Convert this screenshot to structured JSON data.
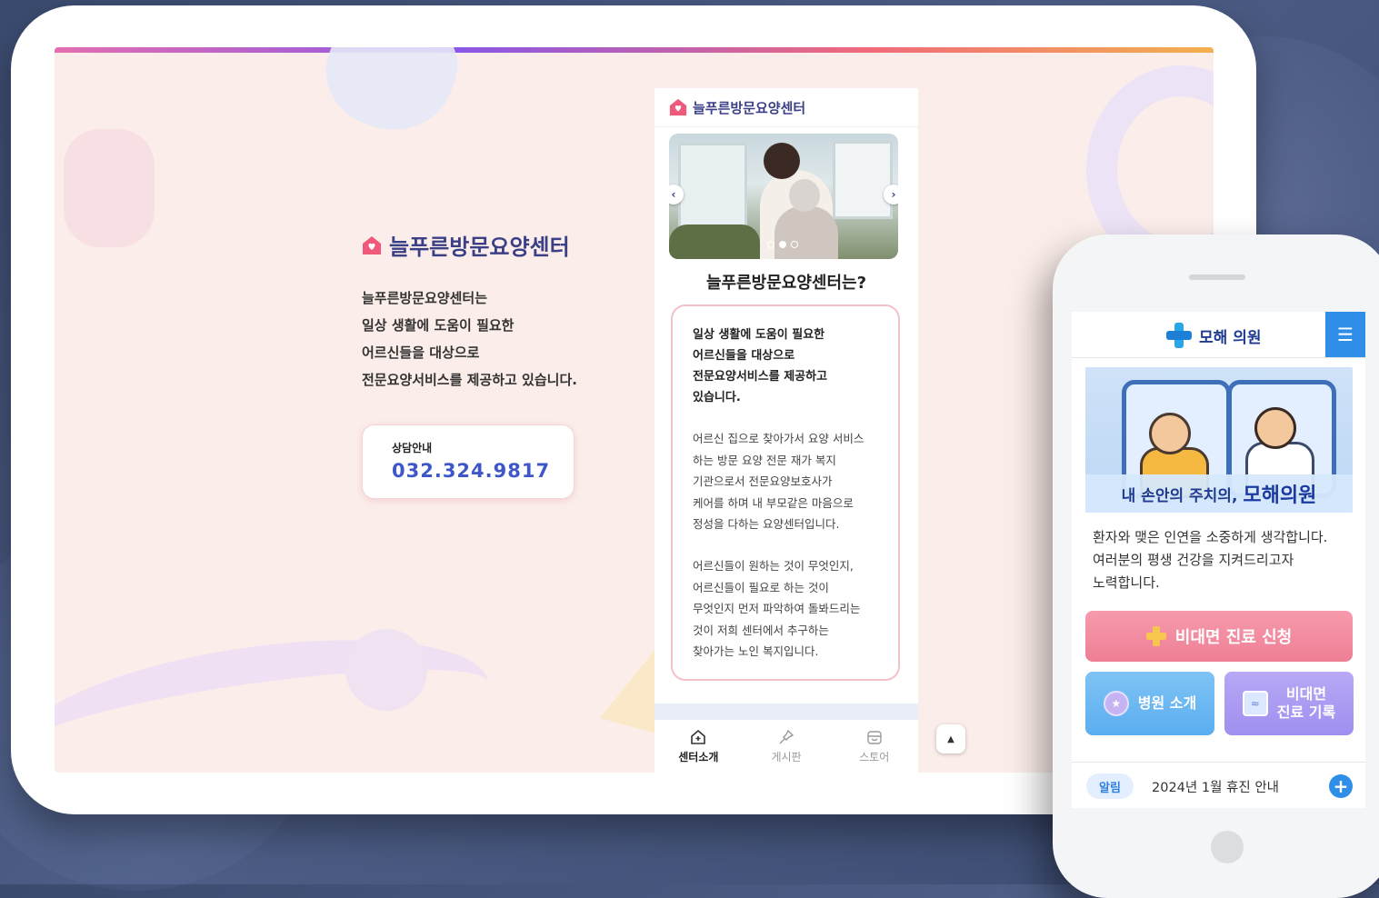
{
  "tablet": {
    "brand_title": "늘푸른방문요양센터",
    "intro_lines": [
      "늘푸른방문요양센터는",
      "일상 생활에 도움이 필요한",
      "어르신들을 대상으로",
      "전문요양서비스를 제공하고 있습니다."
    ],
    "consult": {
      "label": "상담안내",
      "phone": "032.324.9817"
    }
  },
  "mobile": {
    "header_brand": "늘푸른방문요양센터",
    "slider": {
      "prev": "‹",
      "next": "›"
    },
    "heading": "늘푸른방문요양센터는?",
    "card_bold_lines": [
      "일상 생활에 도움이 필요한",
      "어르신들을 대상으로",
      "전문요양서비스를 제공하고",
      "있습니다."
    ],
    "card_p1_lines": [
      "어르신 집으로 찾아가서 요양 서비스",
      "하는 방문 요양 전문 재가 복지",
      "기관으로서 전문요양보호사가",
      "케어를 하며 내 부모같은 마음으로",
      "정성을 다하는 요양센터입니다."
    ],
    "card_p2_lines": [
      "어르신들이 원하는 것이 무엇인지,",
      "어르신들이 필요로 하는 것이",
      "무엇인지 먼저 파악하여 돌봐드리는",
      "것이 저희 센터에서 추구하는",
      "찾아가는 노인 복지입니다."
    ],
    "nav": [
      {
        "label": "센터소개",
        "icon": "home-plus-icon"
      },
      {
        "label": "게시판",
        "icon": "pin-icon"
      },
      {
        "label": "스토어",
        "icon": "store-icon"
      }
    ],
    "top_button": "▲"
  },
  "phone": {
    "brand": "모해 의원",
    "menu_icon": "☰",
    "banner_caption_1": "내 손안의 주치의,",
    "banner_caption_2": "모해의원",
    "text_lines": [
      "환자와 맺은 인연을 소중하게 생각합니다.",
      "여러분의 평생 건강을 지켜드리고자",
      "노력합니다."
    ],
    "btn_main": "비대면 진료 신청",
    "btn_hospital": "병원 소개",
    "btn_record_lines": [
      "비대면",
      "진료 기록"
    ],
    "notice_badge": "알림",
    "notice_text": "2024년 1월 휴진 안내",
    "notice_plus": "+"
  },
  "colors": {
    "brand_navy": "#3a3f86",
    "phone_blue": "#2f8ee8",
    "pink_btn": "#ee7f95",
    "sky_btn": "#5aaef0",
    "lilac_btn": "#9f8ff0"
  }
}
